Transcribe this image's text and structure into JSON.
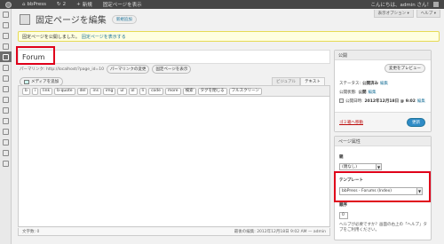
{
  "admin_bar": {
    "site_name": "bbPress",
    "comments_count": "2",
    "plus": "+",
    "new_label": "新規",
    "view_page": "固定ページを表示",
    "greeting": "こんにちは、admin さん！"
  },
  "header": {
    "title": "固定ページを編集",
    "add_new": "新規追加",
    "screen_options": "表示オプション ▾",
    "help": "ヘルプ ▾"
  },
  "notice": {
    "text": "固定ページを公開しました。",
    "link": "固定ページを表示する"
  },
  "editor": {
    "title_value": "Forum",
    "permalink_label": "パーマリンク: http://localhost/?page_id=10",
    "permalink_change": "パーマリンクの変更",
    "permalink_view": "固定ページを表示",
    "add_media": "メディアを追加",
    "tab_visual": "ビジュアル",
    "tab_text": "テキスト",
    "quicktags": [
      "b",
      "i",
      "link",
      "b-quote",
      "del",
      "ins",
      "img",
      "ul",
      "ol",
      "li",
      "code",
      "more",
      "検索",
      "タグを閉じる",
      "フルスクリーン"
    ],
    "word_count": "文字数: 0",
    "last_edited": "最後の編集: 2012年12月18日 9:02 AM — admin"
  },
  "publish": {
    "heading": "公開",
    "preview_button": "変更をプレビュー",
    "status_label": "ステータス:",
    "status_value": "公開済み",
    "visibility_label": "公開状態:",
    "visibility_value": "公開",
    "date_label": "公開日時:",
    "date_value": "2012年12月18日 @ 9:02",
    "edit_link": "編集",
    "trash_link": "ゴミ箱へ移動",
    "update_button": "更新"
  },
  "page_attributes": {
    "heading": "ページ属性",
    "parent_label": "親",
    "parent_value": "(親なし)",
    "template_label": "テンプレート",
    "template_value": "bbPress - Forums (Index)",
    "order_label": "順序",
    "order_value": "0",
    "help_text": "ヘルプが必要ですか？画面の右上の「ヘルプ」タブをご利用ください。"
  },
  "colors": {
    "admin_bar": "#464646",
    "link": "#21759b",
    "notice_bg": "#ffffe0",
    "highlight": "#e0001a",
    "update_button": "#2e8bc6"
  }
}
